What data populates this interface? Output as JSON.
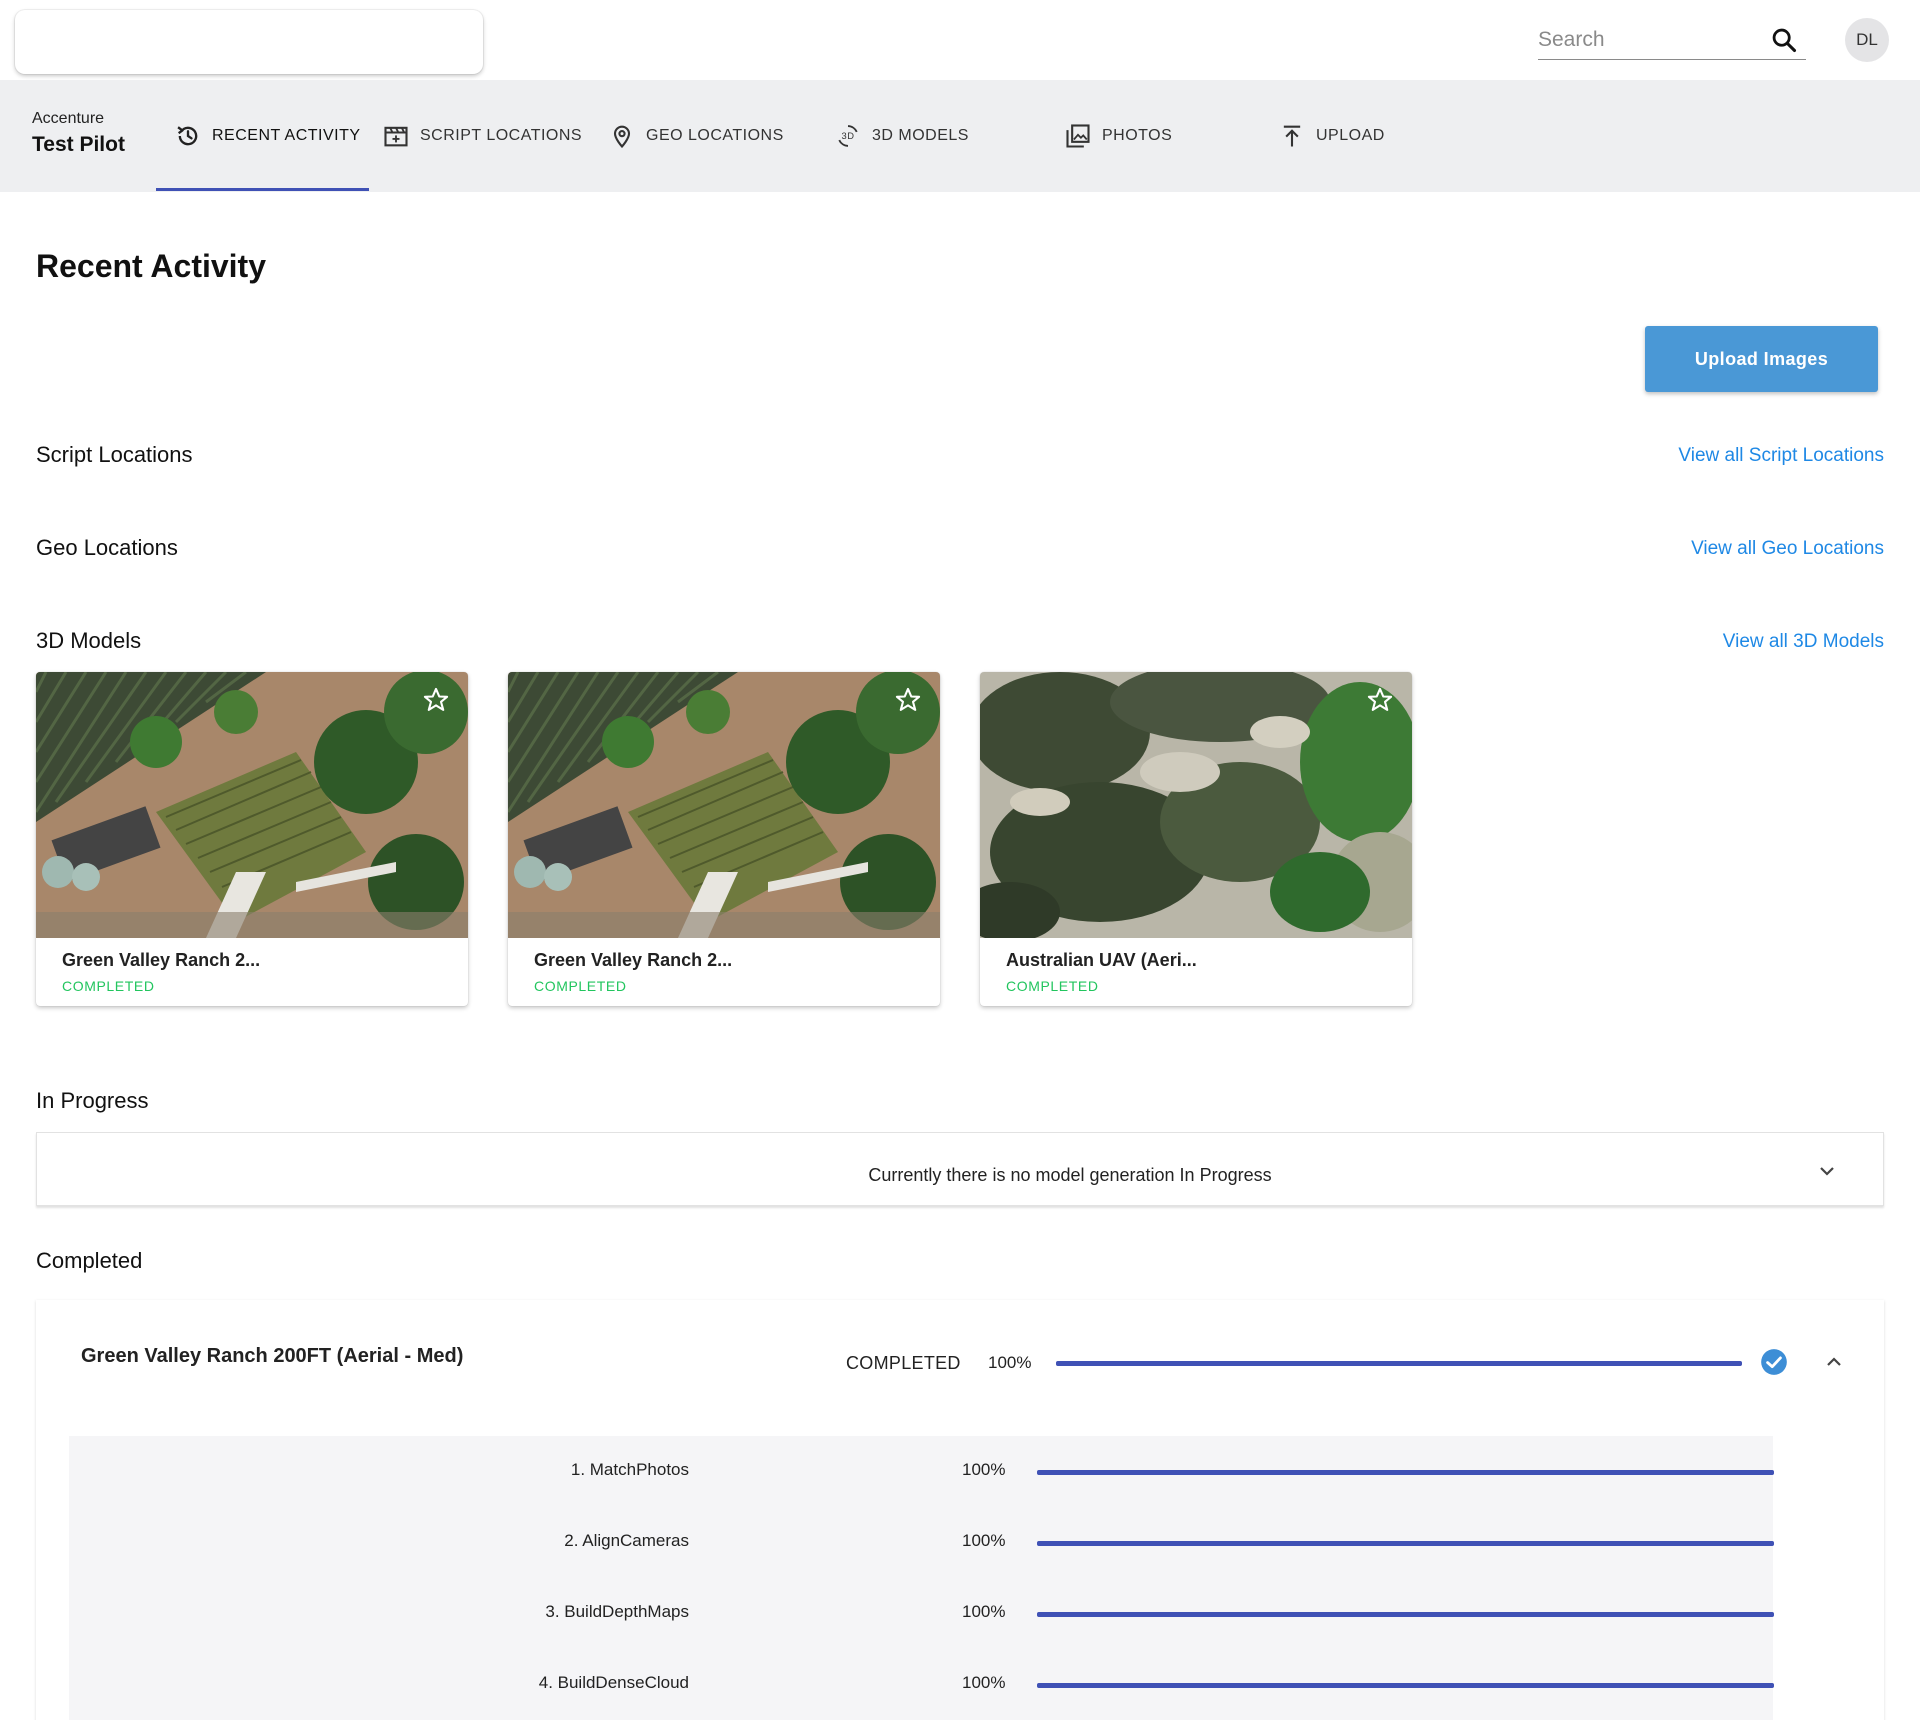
{
  "header": {
    "search_placeholder": "Search",
    "avatar_initials": "DL"
  },
  "brand": {
    "org": "Accenture",
    "app": "Test Pilot"
  },
  "nav": {
    "tabs": [
      {
        "label": "RECENT ACTIVITY",
        "icon": "history-icon",
        "active": true
      },
      {
        "label": "SCRIPT LOCATIONS",
        "icon": "clapperboard-icon",
        "active": false
      },
      {
        "label": "GEO LOCATIONS",
        "icon": "map-pin-icon",
        "active": false
      },
      {
        "label": "3D MODELS",
        "icon": "3d-rotate-icon",
        "active": false
      },
      {
        "label": "PHOTOS",
        "icon": "photo-library-icon",
        "active": false
      },
      {
        "label": "UPLOAD",
        "icon": "upload-icon",
        "active": false
      }
    ]
  },
  "main": {
    "title": "Recent Activity",
    "upload_button": "Upload Images",
    "sections": {
      "script_locations": {
        "title": "Script Locations",
        "link": "View all Script Locations"
      },
      "geo_locations": {
        "title": "Geo Locations",
        "link": "View all Geo Locations"
      },
      "models": {
        "title": "3D Models",
        "link": "View all 3D Models"
      },
      "in_progress": {
        "title": "In Progress",
        "message": "Currently there is no model generation In Progress"
      },
      "completed": {
        "title": "Completed"
      }
    },
    "model_cards": [
      {
        "name": "Green Valley Ranch 2...",
        "status": "COMPLETED"
      },
      {
        "name": "Green Valley Ranch 2...",
        "status": "COMPLETED"
      },
      {
        "name": "Australian UAV (Aeri...",
        "status": "COMPLETED"
      }
    ],
    "completed_job": {
      "title": "Green Valley Ranch 200FT (Aerial - Med)",
      "status": "COMPLETED",
      "percent_label": "100%",
      "progress": 1.0,
      "steps": [
        {
          "label": "1. MatchPhotos",
          "percent_label": "100%",
          "progress": 1.0
        },
        {
          "label": "2. AlignCameras",
          "percent_label": "100%",
          "progress": 1.0
        },
        {
          "label": "3. BuildDepthMaps",
          "percent_label": "100%",
          "progress": 1.0
        },
        {
          "label": "4. BuildDenseCloud",
          "percent_label": "100%",
          "progress": 1.0
        }
      ]
    }
  },
  "colors": {
    "accent": "#3f51b5",
    "link": "#1e88e5",
    "button": "#4a98d6",
    "status_completed": "#22c55e",
    "check": "#3d8ed6"
  }
}
